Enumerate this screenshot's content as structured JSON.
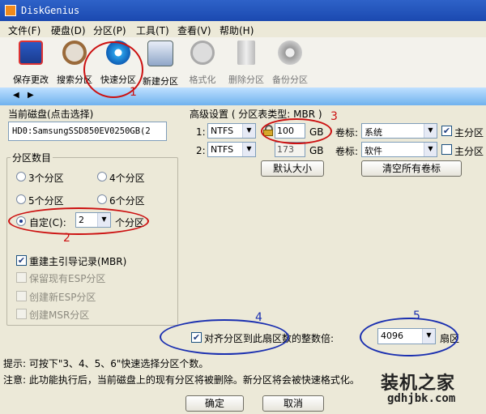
{
  "window": {
    "title": "DiskGenius"
  },
  "menu": [
    {
      "label": "文件(F)"
    },
    {
      "label": "硬盘(D)"
    },
    {
      "label": "分区(P)"
    },
    {
      "label": "工具(T)"
    },
    {
      "label": "查看(V)"
    },
    {
      "label": "帮助(H)"
    }
  ],
  "toolbar": [
    {
      "label": "保存更改"
    },
    {
      "label": "搜索分区"
    },
    {
      "label": "快速分区"
    },
    {
      "label": "新建分区"
    },
    {
      "label": "格式化"
    },
    {
      "label": "删除分区"
    },
    {
      "label": "备份分区"
    }
  ],
  "dialog": {
    "current_disk_label": "当前磁盘(点击选择)",
    "current_disk_value": "HD0:SamsungSSD850EV0250GB(2",
    "partition_count_label": "分区数目",
    "options": [
      "3个分区",
      "4个分区",
      "5个分区",
      "6个分区"
    ],
    "custom_label": "自定(C):",
    "custom_value": "2",
    "custom_suffix": "个分区",
    "rebuild_mbr": "重建主引导记录(MBR)",
    "keep_esp": "保留现有ESP分区",
    "create_esp": "创建新ESP分区",
    "create_msr": "创建MSR分区",
    "advanced_title": "高级设置 ( 分区表类型: MBR )",
    "partitions": [
      {
        "index": "1:",
        "fs": "NTFS",
        "size": "100",
        "unit": "GB",
        "vol_label": "卷标:",
        "vol": "系统",
        "primary_label": "主分区",
        "primary": true
      },
      {
        "index": "2:",
        "fs": "NTFS",
        "size": "173",
        "unit": "GB",
        "vol_label": "卷标:",
        "vol": "软件",
        "primary_label": "主分区",
        "primary": false
      }
    ],
    "default_size_btn": "默认大小",
    "clear_labels_btn": "清空所有卷标",
    "align_label": "对齐分区到此扇区数的整数倍:",
    "align_value": "4096",
    "align_unit": "扇区",
    "hint1": "提示: 可按下\"3、4、5、6\"快速选择分区个数。",
    "hint2": "注意: 此功能执行后，当前磁盘上的现有分区将被删除。新分区将会被快速格式化。",
    "ok_btn": "确定",
    "cancel_btn": "取消"
  },
  "annotations": [
    "1",
    "2",
    "3",
    "4",
    "5"
  ],
  "watermark": {
    "title": "装机之家",
    "url": "gdhjbk.com"
  },
  "colors": {
    "annotation_red": "#cc1111",
    "annotation_blue": "#1a2fb0",
    "titlebar": "#1f4fb8"
  }
}
